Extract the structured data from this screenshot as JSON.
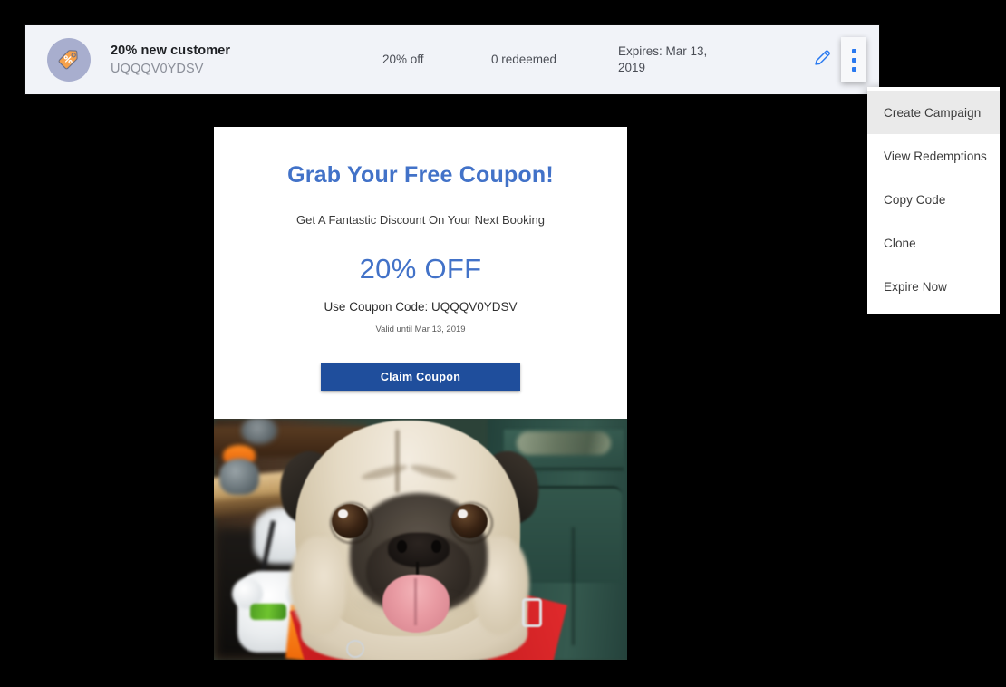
{
  "summary": {
    "icon": "discount-tag-icon",
    "title": "20% new customer",
    "code": "UQQQV0YDSV",
    "discount": "20% off",
    "redeemed": "0 redeemed",
    "expires": "Expires: Mar 13, 2019",
    "edit_icon": "pencil-icon",
    "more_icon": "kebab-menu-icon",
    "accent_color": "#2979f0",
    "background_color": "#f1f3f8"
  },
  "dropdown": {
    "items": [
      {
        "label": "Create Campaign",
        "active": true
      },
      {
        "label": "View Redemptions",
        "active": false
      },
      {
        "label": "Copy Code",
        "active": false
      },
      {
        "label": "Clone",
        "active": false
      },
      {
        "label": "Expire Now",
        "active": false
      }
    ]
  },
  "preview": {
    "headline": "Grab Your Free Coupon!",
    "subhead": "Get A Fantastic Discount On Your Next Booking",
    "discount": "20% OFF",
    "use_code": "Use Coupon Code: UQQQV0YDSV",
    "valid_until": "Valid until Mar 13, 2019",
    "claim_button": "Claim Coupon",
    "headline_color": "#4272c8",
    "button_color": "#1f4e9c",
    "photo_alt": "pug-dog-photo"
  }
}
